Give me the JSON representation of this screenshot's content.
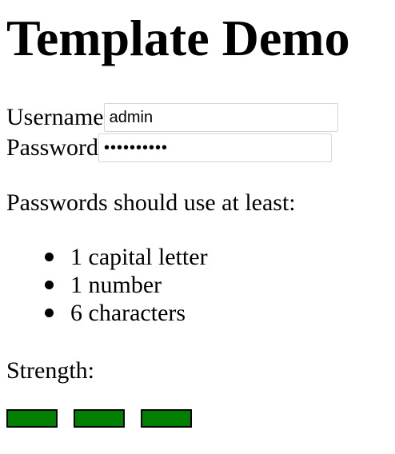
{
  "page": {
    "title": "Template Demo"
  },
  "form": {
    "username": {
      "label": "Username",
      "value": "admin"
    },
    "password": {
      "label": "Password",
      "value": "••••••••••"
    }
  },
  "requirements": {
    "intro": "Passwords should use at least:",
    "items": [
      "1 capital letter",
      "1 number",
      "6 characters"
    ]
  },
  "strength": {
    "label": "Strength:",
    "segments_filled": 3,
    "segments_total": 3,
    "fill_color": "#008000",
    "border_color": "#000000"
  }
}
